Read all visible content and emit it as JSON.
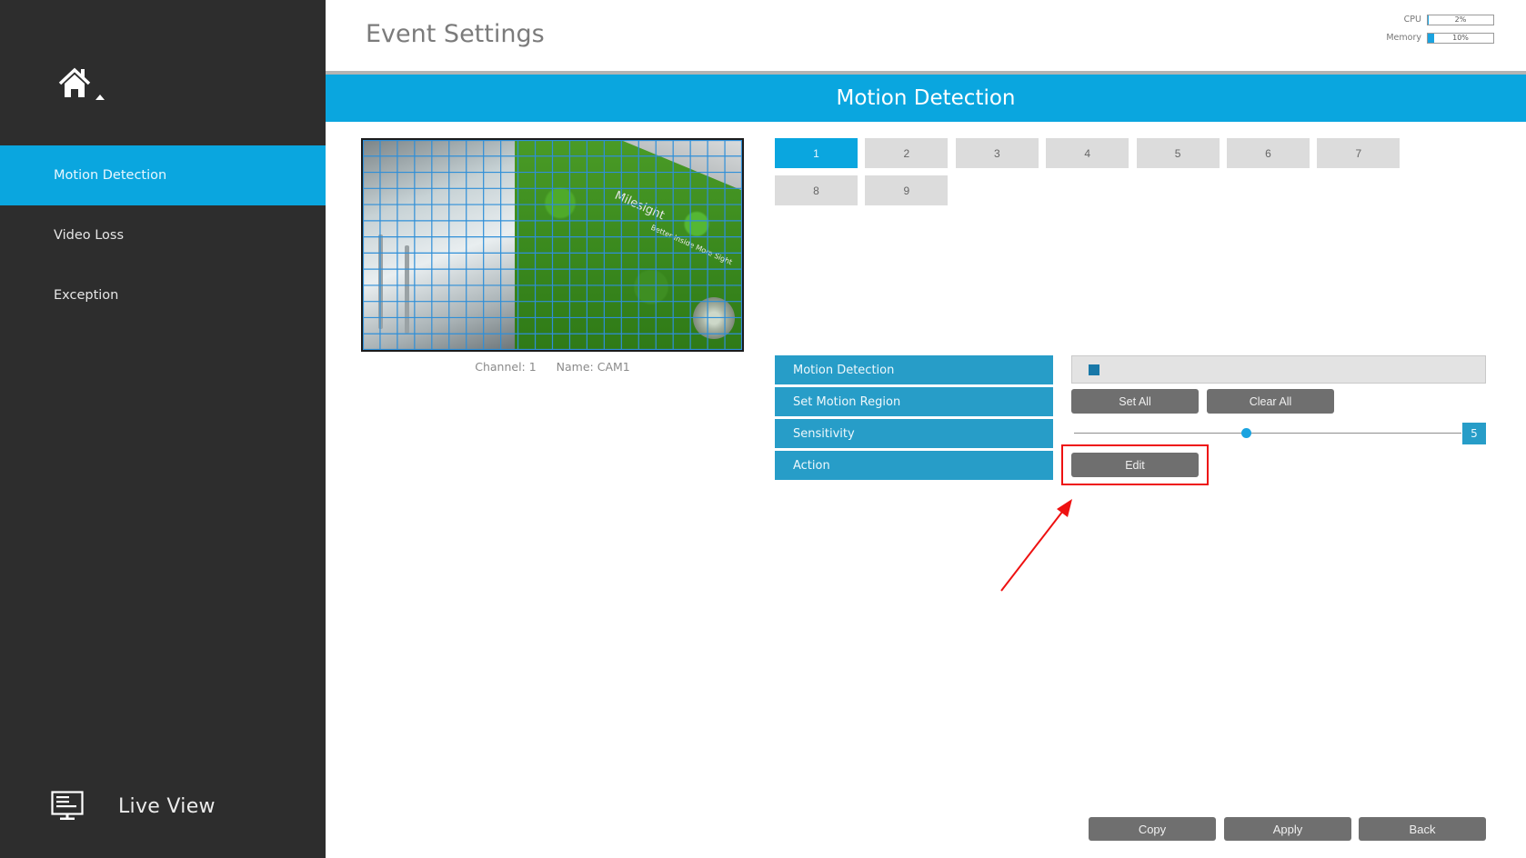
{
  "sidebar": {
    "home_icon": "home-icon",
    "items": [
      {
        "label": "Motion Detection",
        "active": true
      },
      {
        "label": "Video Loss",
        "active": false
      },
      {
        "label": "Exception",
        "active": false
      }
    ],
    "live_view": {
      "label": "Live View",
      "icon": "monitor-icon"
    }
  },
  "header": {
    "title": "Event Settings",
    "usage": {
      "cpu": {
        "label": "CPU",
        "value_text": "2%",
        "percent": 2
      },
      "memory": {
        "label": "Memory",
        "value_text": "10%",
        "percent": 10
      }
    }
  },
  "banner": {
    "title": "Motion Detection"
  },
  "preview": {
    "channel_label": "Channel: 1",
    "name_label": "Name: CAM1",
    "scene_logo": "Milesight",
    "scene_tagline": "Better Inside More Sight",
    "grid": {
      "columns": 22,
      "rows": 13,
      "color": "#2f8fd8"
    }
  },
  "channels": {
    "items": [
      "1",
      "2",
      "3",
      "4",
      "5",
      "6",
      "7",
      "8",
      "9"
    ],
    "selected": "1"
  },
  "settings": {
    "motion_detection": {
      "label": "Motion Detection",
      "enabled": true
    },
    "motion_region": {
      "label": "Set Motion Region",
      "set_all": "Set All",
      "clear_all": "Clear All"
    },
    "sensitivity": {
      "label": "Sensitivity",
      "value": 5,
      "value_text": "5",
      "min": 1,
      "max": 10
    },
    "action": {
      "label": "Action",
      "edit": "Edit"
    }
  },
  "annotation": {
    "highlight_color": "#ee1111",
    "target": "Edit"
  },
  "footer": {
    "copy": "Copy",
    "apply": "Apply",
    "back": "Back"
  },
  "colors": {
    "accent": "#0aa6df",
    "label_blue": "#279dc8",
    "sidebar_bg": "#2d2d2d",
    "button_gray": "#6f6f6f"
  }
}
